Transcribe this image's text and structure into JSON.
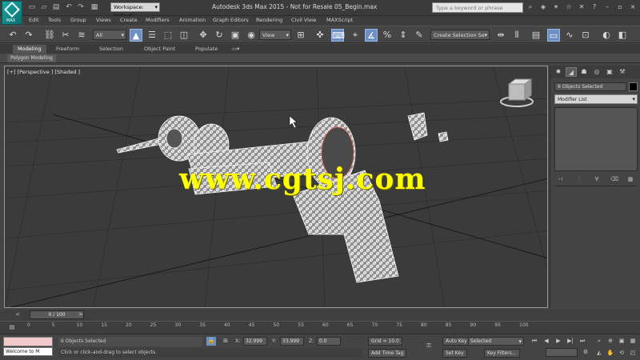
{
  "title_bar": {
    "workspace": "Workspace: Default",
    "window_title": "Autodesk 3ds Max  2015  - Not for Resale   05_Begin.max",
    "search_placeholder": "Type a keyword or phrase"
  },
  "menu": [
    "Edit",
    "Tools",
    "Group",
    "Views",
    "Create",
    "Modifiers",
    "Animation",
    "Graph Editors",
    "Rendering",
    "Civil View",
    "MAXScript"
  ],
  "toolbar": {
    "selection_filter": "All",
    "reference_coord": "View",
    "named_selection": "Create Selection Se"
  },
  "ribbon": {
    "tabs": [
      "Modeling",
      "Freeform",
      "Selection",
      "Object Paint",
      "Populate"
    ],
    "active_tab": "Modeling",
    "sub_label": "Polygon Modeling"
  },
  "viewport": {
    "label": "[+] [Perspective ] [Shaded ]",
    "watermark": "www.cgtsj.com"
  },
  "command_panel": {
    "object_name": "6 Objects Selected",
    "modifier_list": "Modifier List"
  },
  "time_slider": {
    "frame": "0 / 100"
  },
  "track_ticks": [
    "0",
    "5",
    "10",
    "15",
    "20",
    "25",
    "30",
    "35",
    "40",
    "45",
    "50",
    "55",
    "60",
    "65",
    "70",
    "75",
    "80",
    "85",
    "90",
    "95",
    "100"
  ],
  "status_bar": {
    "maxscript_listener": "Welcome to M",
    "selection_status": "6 Objects Selected",
    "prompt": "Click or click-and-drag to select objects",
    "x_label": "X:",
    "x_value": "32.999",
    "y_label": "Y:",
    "y_value": "33.999",
    "z_label": "Z:",
    "z_value": "0.0",
    "grid": "Grid = 10.0",
    "add_time_tag": "Add Time Tag",
    "auto_key": "Auto Key",
    "auto_key_target": "Selected",
    "set_key": "Set Key",
    "key_filters": "Key Filters..."
  },
  "colors": {
    "logo": "#1aa6a6",
    "active_tool": "#6e8fc4",
    "watermark": "#ffff00"
  }
}
